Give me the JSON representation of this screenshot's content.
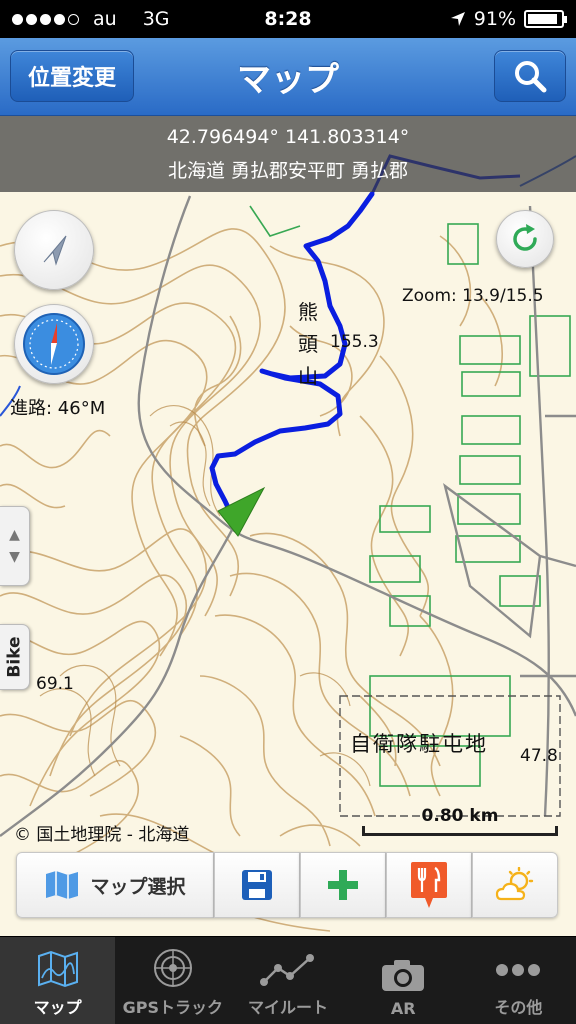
{
  "status_bar": {
    "carrier": "au",
    "network": "3G",
    "time": "8:28",
    "battery": "91%",
    "battery_level": 0.91,
    "signal_bars": 4
  },
  "nav": {
    "title": "マップ",
    "left_button": "位置変更",
    "right_icon": "search-icon"
  },
  "map": {
    "coords": "42.796494° 141.803314°",
    "address": "北海道 勇払郡安平町 勇払郡",
    "zoom": "Zoom: 13.9/15.5",
    "heading": "進路: 46°M",
    "side_tab": "Bike",
    "copyright": "© 国土地理院 - 北海道",
    "scale": "0.80 km",
    "labels": {
      "mountain": [
        "熊",
        "頭",
        "山"
      ],
      "elevation1": "155.3",
      "elevation2": "69.1",
      "elevation3": "47.8",
      "facility": "自衛隊駐屯地"
    },
    "track_color": "#0a1ee0",
    "marker_color": "#3fa62a"
  },
  "toolbar": {
    "map_select": "マップ選択",
    "icons": [
      "save-icon",
      "add-icon",
      "restaurant-icon",
      "weather-icon"
    ]
  },
  "tabs": [
    {
      "label": "マップ",
      "icon": "map-icon",
      "active": true
    },
    {
      "label": "GPSトラック",
      "icon": "radar-icon",
      "active": false
    },
    {
      "label": "マイルート",
      "icon": "route-icon",
      "active": false
    },
    {
      "label": "AR",
      "icon": "camera-icon",
      "active": false
    },
    {
      "label": "その他",
      "icon": "more-icon",
      "active": false
    }
  ]
}
